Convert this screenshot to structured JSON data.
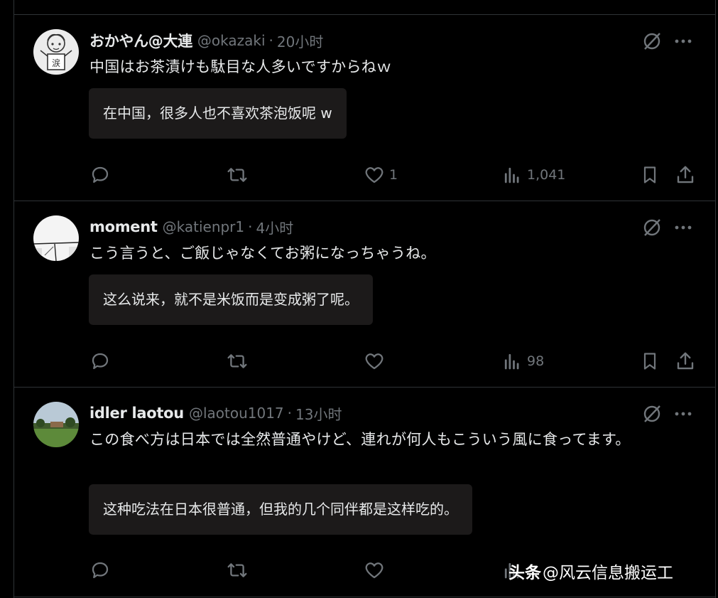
{
  "posts": [
    {
      "name": "おかやん@大連",
      "handle": "@okazaki",
      "separator": "·",
      "time": "20小时",
      "text": "中国はお茶漬けも駄目な人多いですからねｗ",
      "translation": "在中国，很多人也不喜欢茶泡饭呢 w",
      "avatar_icon": "cartoon-drawing-avatar",
      "actions": {
        "reply": "",
        "repost": "",
        "like": "1",
        "views": "1,041"
      }
    },
    {
      "name": "moment",
      "handle": "@katienpr1",
      "separator": "·",
      "time": "4小时",
      "text": "こう言うと、ご飯じゃなくてお粥になっちゃうね。",
      "translation": "这么说来，就不是米饭而是变成粥了呢。",
      "avatar_icon": "white-abstract-avatar",
      "actions": {
        "reply": "",
        "repost": "",
        "like": "",
        "views": "98"
      }
    },
    {
      "name": "idler laotou",
      "handle": "@laotou1017",
      "separator": "·",
      "time": "13小时",
      "text": "この食べ方は日本では全然普通やけど、連れが何人もこういう風に食ってます。",
      "translation": "这种吃法在日本很普通，但我的几个同伴都是这样吃的。",
      "avatar_icon": "landscape-photo-avatar",
      "actions": {
        "reply": "",
        "repost": "",
        "like": "",
        "views": ""
      }
    }
  ],
  "watermark": {
    "brand": "头条",
    "text": "@风云信息搬运工"
  },
  "colors": {
    "background": "#000000",
    "text": "#e7e9ea",
    "muted": "#71767b",
    "divider": "#2f3336",
    "translation_bg": "#1c1a1a"
  },
  "icons": [
    "grok-icon",
    "more-icon",
    "reply-icon",
    "repost-icon",
    "like-icon",
    "views-icon",
    "bookmark-icon",
    "share-icon"
  ]
}
